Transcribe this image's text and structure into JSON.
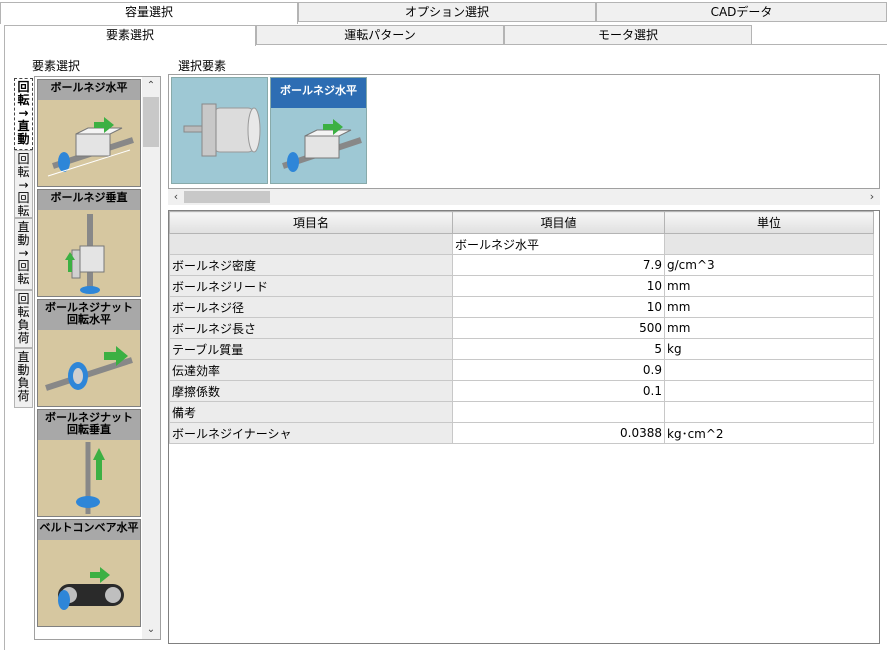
{
  "top_tabs": [
    "容量選択",
    "オプション選択",
    "CADデータ"
  ],
  "sub_tabs": [
    "要素選択",
    "運転パターン",
    "モータ選択"
  ],
  "element_select_label": "要素選択",
  "selected_elements_label": "選択要素",
  "vertical_tabs": [
    "回転→直動",
    "回転→回転",
    "直動→回転",
    "回転負荷",
    "直動負荷"
  ],
  "elements": [
    {
      "label": "ボールネジ水平",
      "icon": "ball-screw-horizontal-icon"
    },
    {
      "label": "ボールネジ垂直",
      "icon": "ball-screw-vertical-icon"
    },
    {
      "label": "ボールネジナット回転水平",
      "icon": "ball-nut-rotation-horizontal-icon"
    },
    {
      "label": "ボールネジナット回転垂直",
      "icon": "ball-nut-rotation-vertical-icon"
    },
    {
      "label": "ベルトコンベア水平",
      "icon": "belt-conveyor-horizontal-icon"
    }
  ],
  "element_labels": {
    "e0": "ボールネジ水平",
    "e1": "ボールネジ垂直",
    "e2a": "ボールネジナット",
    "e2b": "回転水平",
    "e3a": "ボールネジナット",
    "e3b": "回転垂直",
    "e4": "ベルトコンベア水平"
  },
  "selected": [
    {
      "label": "",
      "icon": "motor-icon"
    },
    {
      "label": "ボールネジ水平",
      "icon": "ball-screw-horizontal-icon"
    }
  ],
  "selected_caption": "ボールネジ水平",
  "grid": {
    "headers": [
      "項目名",
      "項目値",
      "単位"
    ],
    "group_value": "ボールネジ水平",
    "rows": [
      {
        "name": "ボールネジ密度",
        "value": "7.9",
        "unit": "g/cm^3"
      },
      {
        "name": "ボールネジリード",
        "value": "10",
        "unit": "mm"
      },
      {
        "name": "ボールネジ径",
        "value": "10",
        "unit": "mm"
      },
      {
        "name": "ボールネジ長さ",
        "value": "500",
        "unit": "mm"
      },
      {
        "name": "テーブル質量",
        "value": "5",
        "unit": "kg"
      },
      {
        "name": "伝達効率",
        "value": "0.9",
        "unit": ""
      },
      {
        "name": "摩擦係数",
        "value": "0.1",
        "unit": ""
      },
      {
        "name": "備考",
        "value": "",
        "unit": ""
      },
      {
        "name": "ボールネジイナーシャ",
        "value": "0.0388",
        "unit": "kg･cm^2"
      }
    ]
  },
  "colors": {
    "selected_caption_bg": "#2d6db3",
    "element_bg": "#d6c7a0",
    "selected_bg": "#9ec8d4"
  }
}
